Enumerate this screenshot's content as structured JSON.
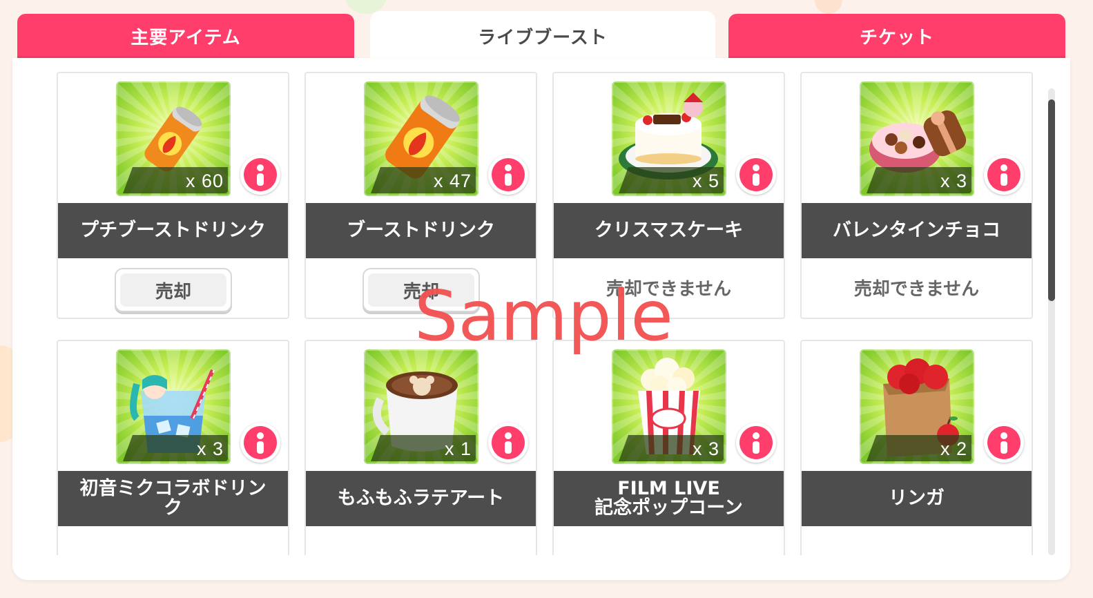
{
  "tabs": [
    {
      "label": "主要アイテム",
      "active": false
    },
    {
      "label": "ライブブースト",
      "active": true
    },
    {
      "label": "チケット",
      "active": false
    }
  ],
  "items": [
    {
      "name": "プチブーストドリンク",
      "qty": "x 60",
      "sell_label": "売却",
      "icon": "small-energy-drink-can-icon"
    },
    {
      "name": "ブーストドリンク",
      "qty": "x 47",
      "sell_label": "売却",
      "icon": "energy-drink-can-icon"
    },
    {
      "name": "クリスマスケーキ",
      "qty": "x 5",
      "sell_label": "売却できません",
      "icon": "christmas-cake-icon"
    },
    {
      "name": "バレンタインチョコ",
      "qty": "x 3",
      "sell_label": "売却できません",
      "icon": "valentine-chocolate-box-icon"
    },
    {
      "name": "初音ミクコラボドリン\nク",
      "qty": "x 3",
      "sell_label": "",
      "icon": "miku-collab-drink-icon"
    },
    {
      "name": "もふもふラテアート",
      "qty": "x 1",
      "sell_label": "",
      "icon": "latte-art-mug-icon"
    },
    {
      "name": "FILM LIVE\n記念ポップコーン",
      "qty": "x 3",
      "sell_label": "",
      "icon": "popcorn-bucket-icon"
    },
    {
      "name": "リンガ",
      "qty": "x 2",
      "sell_label": "",
      "icon": "apple-bag-icon"
    }
  ],
  "watermark": "Sample",
  "colors": {
    "accent": "#ff3e6c",
    "band": "#4d4d4d",
    "icon_bg": "#8fd234"
  }
}
